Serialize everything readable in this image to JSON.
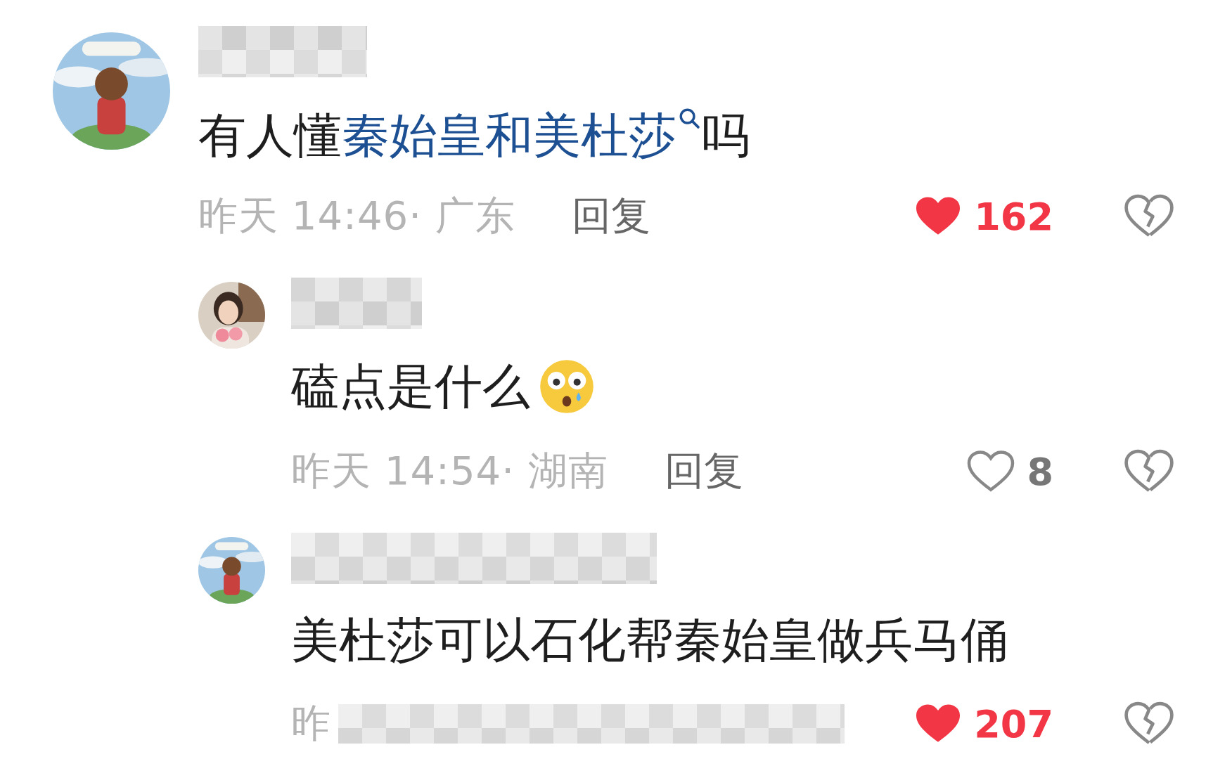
{
  "comments": [
    {
      "avatar": {
        "kind": "scene"
      },
      "segments": [
        {
          "kind": "text",
          "text": "有人懂"
        },
        {
          "kind": "link",
          "text": "秦始皇和美杜莎"
        },
        {
          "kind": "text",
          "text": "吗"
        }
      ],
      "meta": {
        "time": "昨天 14:46· 广东",
        "obscured": false,
        "reply": "回复",
        "likes": "162",
        "liked": true
      },
      "children": [
        {
          "avatar": {
            "kind": "portrait"
          },
          "segments": [
            {
              "kind": "text",
              "text": "磕点是什么"
            },
            {
              "kind": "emoji"
            }
          ],
          "meta": {
            "time": "昨天 14:54· 湖南",
            "obscured": false,
            "reply": "回复",
            "likes": "8",
            "liked": false
          }
        },
        {
          "avatar": {
            "kind": "scene"
          },
          "segments": [
            {
              "kind": "text",
              "text": "美杜莎可以石化帮秦始皇做兵马俑"
            }
          ],
          "meta": {
            "time": "昨",
            "obscured": true,
            "likes": "207",
            "liked": true
          }
        }
      ]
    }
  ]
}
